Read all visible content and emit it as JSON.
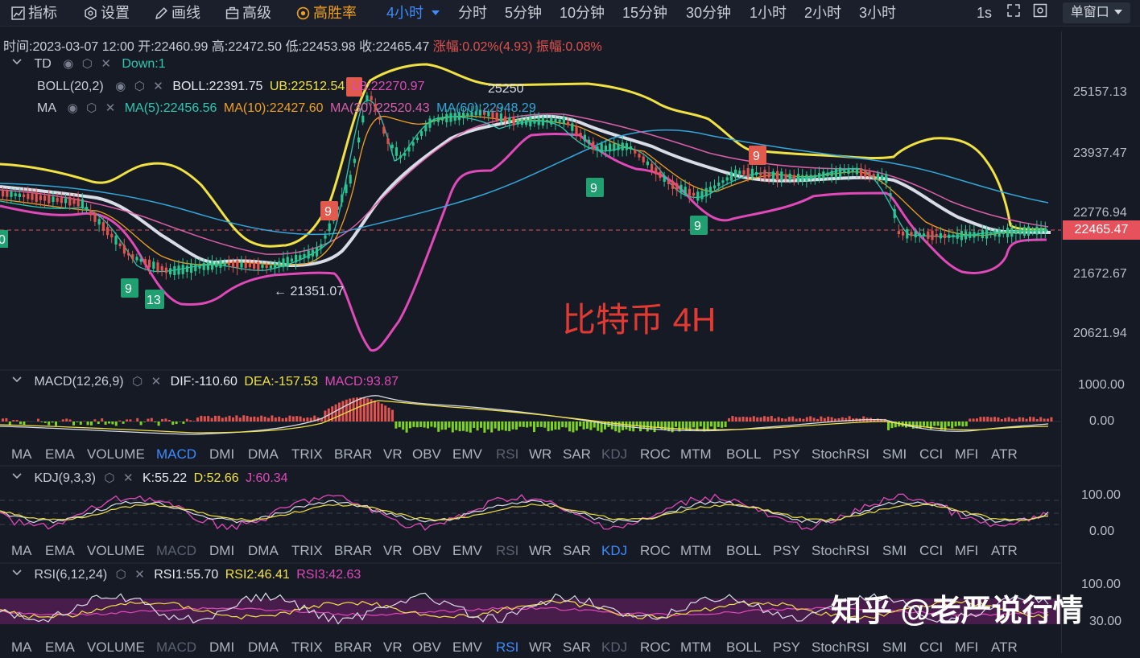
{
  "toolbar": {
    "indicators_label": "指标",
    "settings_label": "设置",
    "draw_label": "画线",
    "advanced_label": "高级",
    "winrate_label": "高胜率",
    "active_timeframe": "4小时",
    "timeframes": [
      "分时",
      "5分钟",
      "10分钟",
      "15分钟",
      "30分钟",
      "1小时",
      "2小时",
      "3小时"
    ],
    "interval_label": "1s",
    "window_button": "单窗口"
  },
  "ohlc": {
    "time_label": "时间:2023-03-07 12:00",
    "open": "开:22460.99",
    "high": "高:22472.50",
    "low": "低:22453.98",
    "close": "收:22465.47",
    "change": "涨幅:0.02%(4.93)",
    "amplitude": "振幅:0.08%"
  },
  "main_indicators": {
    "td_name": "TD",
    "td_value": "Down:1",
    "boll_name": "BOLL(20,2)",
    "boll_value": "BOLL:22391.75",
    "boll_ub": "UB:22512.54",
    "boll_lb": "LB:22270.97",
    "ma_name": "MA",
    "ma5": "MA(5):22456.56",
    "ma10": "MA(10):22427.60",
    "ma30": "MA(30):22520.43",
    "ma60": "MA(60):22948.29"
  },
  "price_axis": {
    "ticks": [
      "25157.13",
      "23937.47",
      "22776.94",
      "21672.67",
      "20621.94"
    ],
    "current_price": "22465.47"
  },
  "chart_annotations": {
    "high_marker": "25250",
    "low_marker": "← 21351.07",
    "td_counts": [
      "9",
      "13",
      "9",
      "9",
      "9",
      "9"
    ],
    "title": "比特币 4H"
  },
  "macd": {
    "name": "MACD(12,26,9)",
    "dif": "DIF:-110.60",
    "dea": "DEA:-157.53",
    "macd": "MACD:93.87",
    "axis": [
      "1000.00",
      "0.00"
    ]
  },
  "kdj": {
    "name": "KDJ(9,3,3)",
    "k": "K:55.22",
    "d": "D:52.66",
    "j": "J:60.34",
    "axis": [
      "100.00",
      "0.00"
    ]
  },
  "rsi": {
    "name": "RSI(6,12,24)",
    "rsi1": "RSI1:55.70",
    "rsi2": "RSI2:46.41",
    "rsi3": "RSI3:42.63",
    "axis": [
      "100.00",
      "30.00"
    ]
  },
  "indicator_tabs": [
    "MA",
    "EMA",
    "VOLUME",
    "MACD",
    "DMI",
    "DMA",
    "TRIX",
    "BRAR",
    "VR",
    "OBV",
    "EMV",
    "RSI",
    "WR",
    "SAR",
    "KDJ",
    "ROC",
    "MTM",
    "BOLL",
    "PSY",
    "StochRSI",
    "SMI",
    "CCI",
    "MFI",
    "ATR"
  ],
  "watermark": "知乎 @老严说行情",
  "colors": {
    "background": "#161a25",
    "up": "#26c68f",
    "down": "#e0524d",
    "boll_band": "#f1e243",
    "boll_mid": "#d8dce6",
    "lb_band": "#e049b8",
    "accent": "#3d8bfd"
  }
}
